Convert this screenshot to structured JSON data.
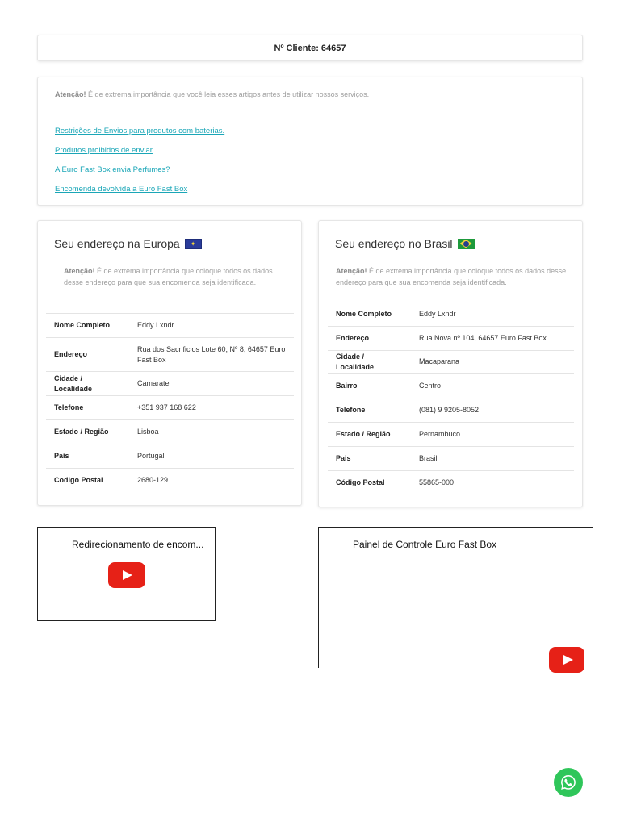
{
  "client": {
    "label": "Nº Cliente: 64657"
  },
  "info": {
    "attention_strong": "Atenção!",
    "attention_text": " É de extrema importância que você leia esses artigos antes de utilizar nossos serviços.",
    "links": [
      "Restrições de Envios para produtos com baterias.",
      "Produtos proibidos de enviar",
      "A Euro Fast Box envia Perfumes?",
      "Encomenda devolvida a Euro Fast Box"
    ]
  },
  "europe": {
    "title": "Seu endereço na Europa",
    "attention_strong": "Atenção!",
    "attention_text": " É de extrema importância que coloque todos os dados desse endereço para que sua encomenda seja identificada.",
    "rows": [
      {
        "k": "Nome Completo",
        "v": "Eddy Lxndr"
      },
      {
        "k": "Endereço",
        "v": "Rua dos Sacrificios Lote 60, Nº 8, 64657 Euro Fast Box"
      },
      {
        "k": "Cidade / Localidade",
        "v": "Camarate"
      },
      {
        "k": "Telefone",
        "v": "+351 937 168 622"
      },
      {
        "k": "Estado / Região",
        "v": "Lisboa"
      },
      {
        "k": "Pais",
        "v": "Portugal"
      },
      {
        "k": "Codigo Postal",
        "v": "2680-129"
      }
    ]
  },
  "brazil": {
    "title": "Seu endereço no Brasil",
    "attention_strong": "Atenção!",
    "attention_text": " É de extrema importância que coloque todos os dados desse endereço para que sua encomenda seja identificada.",
    "rows": [
      {
        "k": "Nome Completo",
        "v": "Eddy Lxndr"
      },
      {
        "k": "Endereço",
        "v": "Rua Nova nº 104, 64657 Euro Fast Box"
      },
      {
        "k": "Cidade / Localidade",
        "v": "Macaparana"
      },
      {
        "k": "Bairro",
        "v": "Centro"
      },
      {
        "k": "Telefone",
        "v": "(081) 9 9205-8052"
      },
      {
        "k": "Estado / Região",
        "v": "Pernambuco"
      },
      {
        "k": "Pais",
        "v": "Brasil"
      },
      {
        "k": "Código Postal",
        "v": "55865-000"
      }
    ]
  },
  "videos": [
    {
      "title": "Redirecionamento de encom..."
    },
    {
      "title": "Painel de Controle Euro Fast Box"
    }
  ],
  "colors": {
    "link": "#1aa6b7",
    "youtube": "#e62117",
    "whatsapp": "#2fc65a"
  }
}
